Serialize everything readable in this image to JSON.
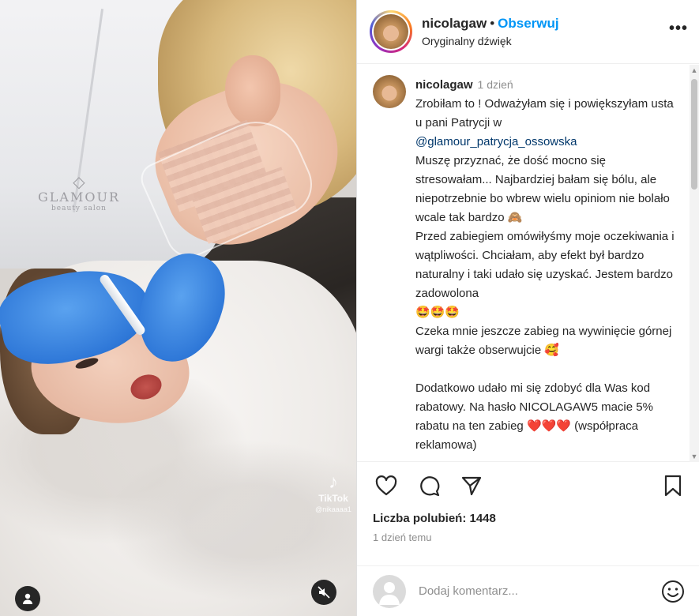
{
  "media": {
    "brand_name": "GLAMOUR",
    "brand_sub": "beauty salon",
    "tiktok_label": "TikTok",
    "tiktok_user": "@nikaaaa1"
  },
  "header": {
    "username": "nicolagaw",
    "separator": "•",
    "follow_label": "Obserwuj",
    "audio_label": "Oryginalny dźwięk",
    "more_label": "•••"
  },
  "caption": {
    "username": "nicolagaw",
    "time": "1 dzień",
    "p1": "Zrobiłam to ! Odważyłam się i powiększyłam usta u pani Patrycji w",
    "mention": "@glamour_patrycja_ossowska",
    "p2": "Muszę przyznać, że dość mocno się stresowałam... Najbardziej bałam się bólu, ale niepotrzebnie bo wbrew wielu opiniom nie bolało wcale tak bardzo 🙈",
    "p3": "Przed zabiegiem omówiłyśmy moje oczekiwania i wątpliwości. Chciałam, aby efekt był bardzo naturalny i taki udało się uzyskać. Jestem bardzo zadowolona",
    "p3_emoji": "🤩🤩🤩",
    "p4": "Czeka mnie jeszcze zabieg na wywinięcie górnej wargi także obserwujcie 🥰",
    "p5": "Dodatkowo udało mi się zdobyć dla Was kod rabatowy. Na hasło NICOLAGAW5 macie 5% rabatu na ten zabieg",
    "p5_emoji": "❤️❤️❤️",
    "p5_tail": "(współpraca reklamowa)"
  },
  "footer": {
    "likes": "Liczba polubień: 1448",
    "when": "1 dzień temu",
    "comment_placeholder": "Dodaj komentarz..."
  },
  "colors": {
    "accent": "#0095f6",
    "mention": "#00376b",
    "text": "#262626",
    "muted": "#8e8e8e"
  }
}
